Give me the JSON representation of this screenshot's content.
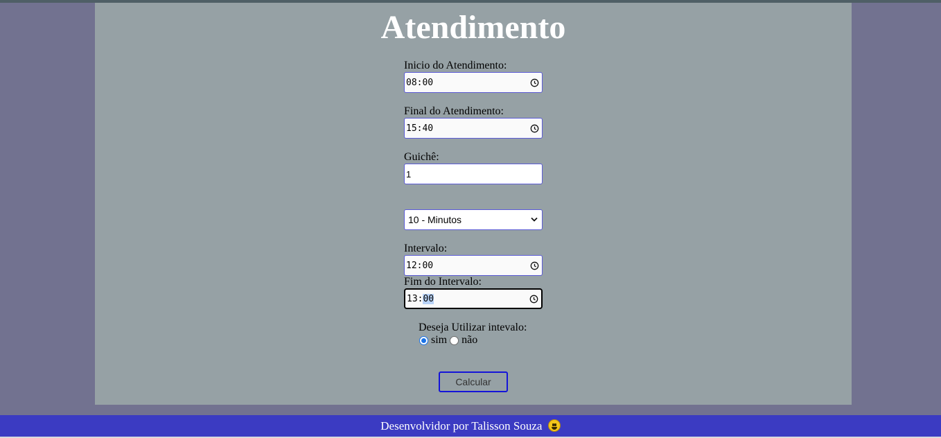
{
  "page": {
    "title": "Atendimento"
  },
  "form": {
    "inicio": {
      "label": "Inicio do Atendimento:",
      "hour": "08",
      "minute": "00"
    },
    "final": {
      "label": "Final do Atendimento:",
      "hour": "15",
      "minute": "40"
    },
    "guiche": {
      "label": "Guichê:",
      "value": "1"
    },
    "duracao": {
      "selected": "10 - Minutos"
    },
    "intervalo": {
      "label": "Intervalo:",
      "hour": "12",
      "minute": "00"
    },
    "fim_intervalo": {
      "label": "Fim do Intervalo:",
      "hour": "13",
      "minute": "00"
    },
    "usar_intervalo": {
      "question": "Deseja Utilizar intevalo:",
      "options": [
        {
          "label": "sim",
          "checked": true
        },
        {
          "label": "não",
          "checked": false
        }
      ]
    },
    "calcular_label": "Calcular"
  },
  "footer": {
    "text": "Desenvolvidor por Talisson Souza"
  },
  "icons": {
    "time": "clock-icon",
    "select": "chevron-down-icon",
    "footer": "smiley-emoji-icon"
  },
  "colors": {
    "background": "#727290",
    "panel": "#96a1a5",
    "footer": "#3b3bc2",
    "button_border": "#1414d8"
  }
}
